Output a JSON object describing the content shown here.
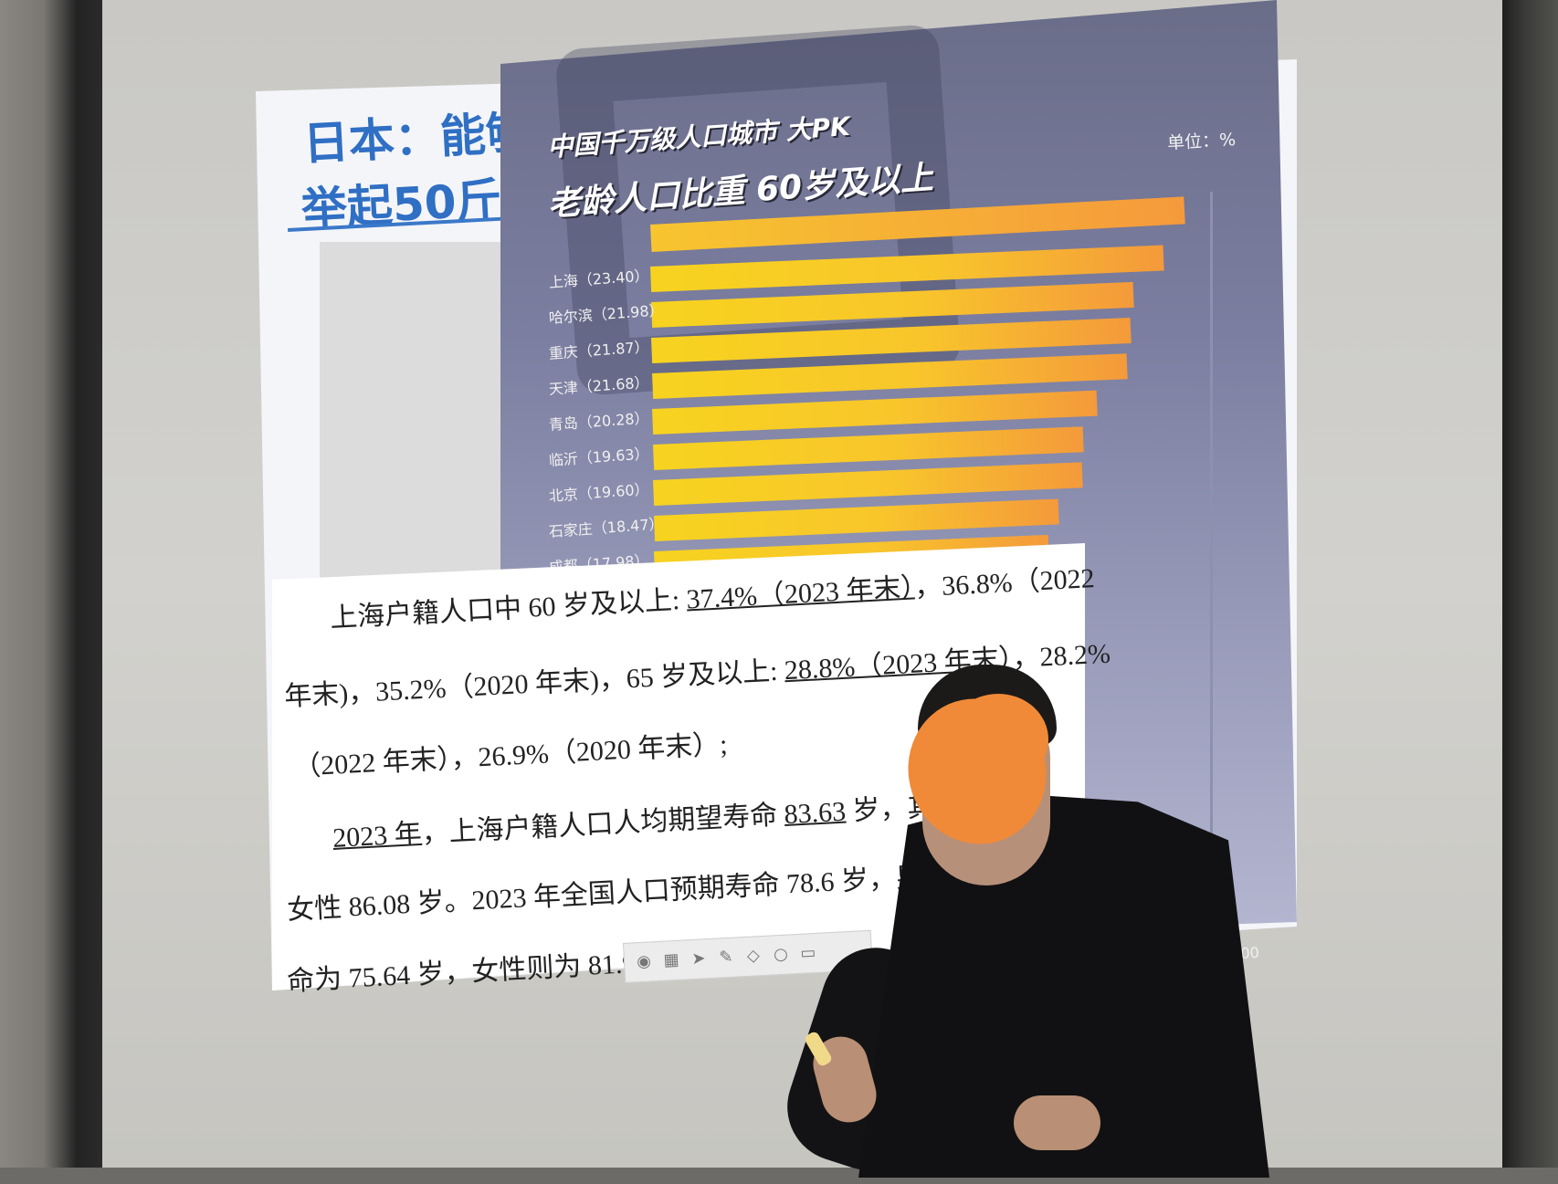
{
  "slide": {
    "title_line1": "日本：能够",
    "title_line2": "举起50斤重"
  },
  "chart": {
    "title_line1": "中国千万级人口城市 大PK",
    "title_line2": "老龄人口比重 60岁及以上",
    "unit": "单位：%",
    "axis_tick": "25.00",
    "categories": [
      {
        "label": "上海（23.40）"
      },
      {
        "label": "哈尔滨（21.98）"
      },
      {
        "label": "重庆（21.87）"
      },
      {
        "label": "天津（21.68）"
      },
      {
        "label": "青岛（20.28）"
      },
      {
        "label": "临沂（19.63）"
      },
      {
        "label": "北京（19.60）"
      },
      {
        "label": "石家庄（18.47）"
      },
      {
        "label": "成都（17.98）"
      }
    ]
  },
  "chart_data": {
    "type": "bar",
    "title": "中国千万级人口城市 大PK 老龄人口比重 60岁及以上",
    "categories": [
      "上海",
      "哈尔滨",
      "重庆",
      "天津",
      "青岛",
      "临沂",
      "北京",
      "石家庄",
      "成都"
    ],
    "values": [
      23.4,
      21.98,
      21.87,
      21.68,
      20.28,
      19.63,
      19.6,
      18.47,
      17.98
    ],
    "ylabel": "单位：%",
    "xlim": [
      0,
      25
    ]
  },
  "document": {
    "line1_a": "上海户籍人口中 60 岁及以上: ",
    "line1_u": "37.4%（2023 年末）",
    "line1_b": "，36.8%（2022",
    "line2_a": "年末)，35.2%（2020 年末)，65 岁及以上: ",
    "line2_u": "28.8%（2023 年末）",
    "line2_b": "，28.2%",
    "line3": "（2022 年末），26.9%（2020 年末）;",
    "line4_u1": "2023 年",
    "line4_a": "，上海户籍人口人均期望寿命 ",
    "line4_u2": "83.63",
    "line4_b": " 岁，其中男",
    "line5": "女性 86.08 岁。2023 年全国人口预期寿命 78.6 岁，男性",
    "line6": "命为 75.64 岁，女性则为 81.9 岁"
  },
  "toolbar": {
    "icons": [
      "eye-icon",
      "grid-icon",
      "cursor-icon",
      "pen-icon",
      "eraser-icon",
      "zoom-icon",
      "screen-icon"
    ]
  }
}
